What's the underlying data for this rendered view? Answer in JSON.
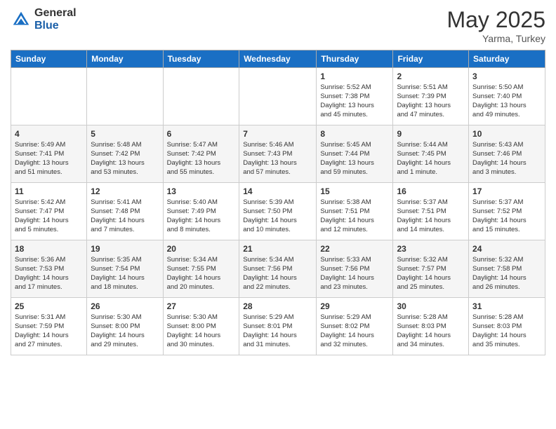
{
  "header": {
    "logo_general": "General",
    "logo_blue": "Blue",
    "month": "May 2025",
    "location": "Yarma, Turkey"
  },
  "days_of_week": [
    "Sunday",
    "Monday",
    "Tuesday",
    "Wednesday",
    "Thursday",
    "Friday",
    "Saturday"
  ],
  "weeks": [
    [
      {
        "day": "",
        "info": ""
      },
      {
        "day": "",
        "info": ""
      },
      {
        "day": "",
        "info": ""
      },
      {
        "day": "",
        "info": ""
      },
      {
        "day": "1",
        "info": "Sunrise: 5:52 AM\nSunset: 7:38 PM\nDaylight: 13 hours\nand 45 minutes."
      },
      {
        "day": "2",
        "info": "Sunrise: 5:51 AM\nSunset: 7:39 PM\nDaylight: 13 hours\nand 47 minutes."
      },
      {
        "day": "3",
        "info": "Sunrise: 5:50 AM\nSunset: 7:40 PM\nDaylight: 13 hours\nand 49 minutes."
      }
    ],
    [
      {
        "day": "4",
        "info": "Sunrise: 5:49 AM\nSunset: 7:41 PM\nDaylight: 13 hours\nand 51 minutes."
      },
      {
        "day": "5",
        "info": "Sunrise: 5:48 AM\nSunset: 7:42 PM\nDaylight: 13 hours\nand 53 minutes."
      },
      {
        "day": "6",
        "info": "Sunrise: 5:47 AM\nSunset: 7:42 PM\nDaylight: 13 hours\nand 55 minutes."
      },
      {
        "day": "7",
        "info": "Sunrise: 5:46 AM\nSunset: 7:43 PM\nDaylight: 13 hours\nand 57 minutes."
      },
      {
        "day": "8",
        "info": "Sunrise: 5:45 AM\nSunset: 7:44 PM\nDaylight: 13 hours\nand 59 minutes."
      },
      {
        "day": "9",
        "info": "Sunrise: 5:44 AM\nSunset: 7:45 PM\nDaylight: 14 hours\nand 1 minute."
      },
      {
        "day": "10",
        "info": "Sunrise: 5:43 AM\nSunset: 7:46 PM\nDaylight: 14 hours\nand 3 minutes."
      }
    ],
    [
      {
        "day": "11",
        "info": "Sunrise: 5:42 AM\nSunset: 7:47 PM\nDaylight: 14 hours\nand 5 minutes."
      },
      {
        "day": "12",
        "info": "Sunrise: 5:41 AM\nSunset: 7:48 PM\nDaylight: 14 hours\nand 7 minutes."
      },
      {
        "day": "13",
        "info": "Sunrise: 5:40 AM\nSunset: 7:49 PM\nDaylight: 14 hours\nand 8 minutes."
      },
      {
        "day": "14",
        "info": "Sunrise: 5:39 AM\nSunset: 7:50 PM\nDaylight: 14 hours\nand 10 minutes."
      },
      {
        "day": "15",
        "info": "Sunrise: 5:38 AM\nSunset: 7:51 PM\nDaylight: 14 hours\nand 12 minutes."
      },
      {
        "day": "16",
        "info": "Sunrise: 5:37 AM\nSunset: 7:51 PM\nDaylight: 14 hours\nand 14 minutes."
      },
      {
        "day": "17",
        "info": "Sunrise: 5:37 AM\nSunset: 7:52 PM\nDaylight: 14 hours\nand 15 minutes."
      }
    ],
    [
      {
        "day": "18",
        "info": "Sunrise: 5:36 AM\nSunset: 7:53 PM\nDaylight: 14 hours\nand 17 minutes."
      },
      {
        "day": "19",
        "info": "Sunrise: 5:35 AM\nSunset: 7:54 PM\nDaylight: 14 hours\nand 18 minutes."
      },
      {
        "day": "20",
        "info": "Sunrise: 5:34 AM\nSunset: 7:55 PM\nDaylight: 14 hours\nand 20 minutes."
      },
      {
        "day": "21",
        "info": "Sunrise: 5:34 AM\nSunset: 7:56 PM\nDaylight: 14 hours\nand 22 minutes."
      },
      {
        "day": "22",
        "info": "Sunrise: 5:33 AM\nSunset: 7:56 PM\nDaylight: 14 hours\nand 23 minutes."
      },
      {
        "day": "23",
        "info": "Sunrise: 5:32 AM\nSunset: 7:57 PM\nDaylight: 14 hours\nand 25 minutes."
      },
      {
        "day": "24",
        "info": "Sunrise: 5:32 AM\nSunset: 7:58 PM\nDaylight: 14 hours\nand 26 minutes."
      }
    ],
    [
      {
        "day": "25",
        "info": "Sunrise: 5:31 AM\nSunset: 7:59 PM\nDaylight: 14 hours\nand 27 minutes."
      },
      {
        "day": "26",
        "info": "Sunrise: 5:30 AM\nSunset: 8:00 PM\nDaylight: 14 hours\nand 29 minutes."
      },
      {
        "day": "27",
        "info": "Sunrise: 5:30 AM\nSunset: 8:00 PM\nDaylight: 14 hours\nand 30 minutes."
      },
      {
        "day": "28",
        "info": "Sunrise: 5:29 AM\nSunset: 8:01 PM\nDaylight: 14 hours\nand 31 minutes."
      },
      {
        "day": "29",
        "info": "Sunrise: 5:29 AM\nSunset: 8:02 PM\nDaylight: 14 hours\nand 32 minutes."
      },
      {
        "day": "30",
        "info": "Sunrise: 5:28 AM\nSunset: 8:03 PM\nDaylight: 14 hours\nand 34 minutes."
      },
      {
        "day": "31",
        "info": "Sunrise: 5:28 AM\nSunset: 8:03 PM\nDaylight: 14 hours\nand 35 minutes."
      }
    ]
  ]
}
